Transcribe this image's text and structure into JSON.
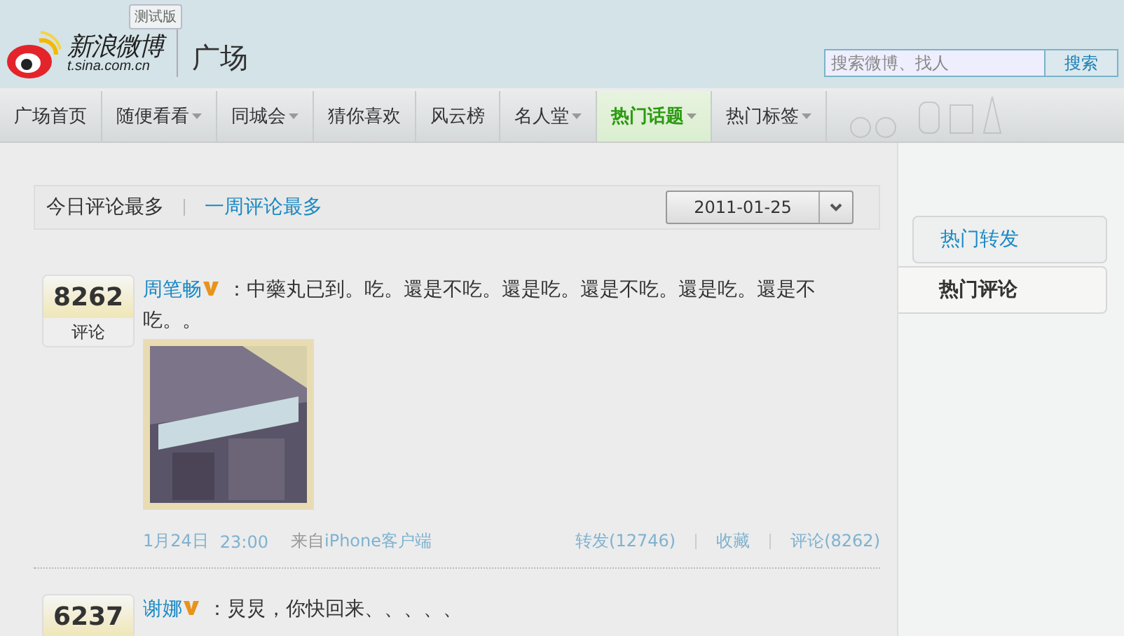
{
  "header": {
    "logo_text": "新浪微博",
    "logo_url": "t.sina.com.cn",
    "beta_badge": "测试版",
    "section_title": "广场",
    "search": {
      "placeholder": "搜索微博、找人",
      "button": "搜索"
    }
  },
  "nav": [
    {
      "label": "广场首页",
      "dropdown": false,
      "selected": false
    },
    {
      "label": "随便看看",
      "dropdown": true,
      "selected": false
    },
    {
      "label": "同城会",
      "dropdown": true,
      "selected": false
    },
    {
      "label": "猜你喜欢",
      "dropdown": false,
      "selected": false
    },
    {
      "label": "风云榜",
      "dropdown": false,
      "selected": false
    },
    {
      "label": "名人堂",
      "dropdown": true,
      "selected": false
    },
    {
      "label": "热门话题",
      "dropdown": true,
      "selected": true
    },
    {
      "label": "热门标签",
      "dropdown": true,
      "selected": false
    }
  ],
  "filter_tabs": [
    {
      "label": "今日评论最多",
      "selected": true
    },
    {
      "label": "一周评论最多",
      "selected": false
    }
  ],
  "date_select": "2011-01-25",
  "posts": [
    {
      "count": "8262",
      "count_label": "评论",
      "author": "周笔畅",
      "verified": true,
      "text": "：中藥丸已到。吃。還是不吃。還是吃。還是不吃。還是吃。還是不吃。。",
      "date": "1月24日",
      "time": "23:00",
      "source_prefix": "来自",
      "source": "iPhone客户端",
      "repost": "转发(12746)",
      "favorite": "收藏",
      "comment": "评论(8262)"
    },
    {
      "count": "6237",
      "author": "谢娜",
      "verified": true,
      "text": "：炅炅，你快回来、、、、、"
    }
  ],
  "side_tabs": [
    {
      "label": "热门转发",
      "selected": false
    },
    {
      "label": "热门评论",
      "selected": true
    }
  ]
}
